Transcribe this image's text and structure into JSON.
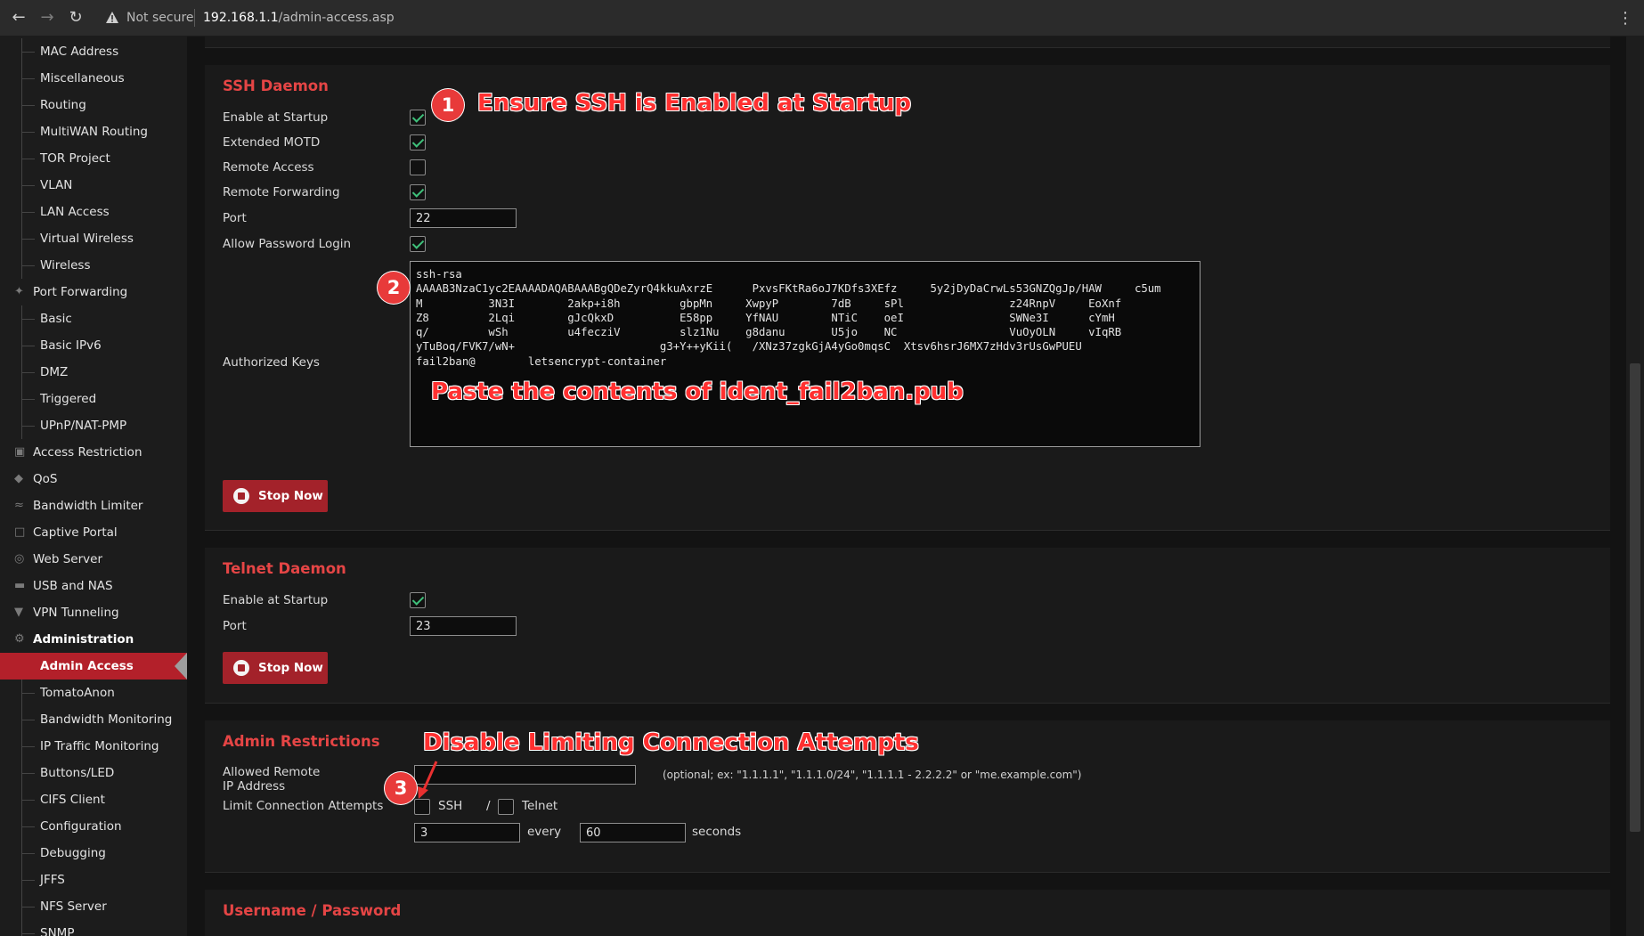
{
  "browser": {
    "security_label": "Not secure",
    "url_host": "192.168.1.1",
    "url_path": "/admin-access.asp"
  },
  "sidebar": {
    "items": [
      {
        "label": "MAC Address",
        "kind": "child"
      },
      {
        "label": "Miscellaneous",
        "kind": "child"
      },
      {
        "label": "Routing",
        "kind": "child"
      },
      {
        "label": "MultiWAN Routing",
        "kind": "child"
      },
      {
        "label": "TOR Project",
        "kind": "child"
      },
      {
        "label": "VLAN",
        "kind": "child"
      },
      {
        "label": "LAN Access",
        "kind": "child"
      },
      {
        "label": "Virtual Wireless",
        "kind": "child"
      },
      {
        "label": "Wireless",
        "kind": "child"
      },
      {
        "label": "Port Forwarding",
        "kind": "parent",
        "icon": "port-forwarding-icon"
      },
      {
        "label": "Basic",
        "kind": "child"
      },
      {
        "label": "Basic IPv6",
        "kind": "child"
      },
      {
        "label": "DMZ",
        "kind": "child"
      },
      {
        "label": "Triggered",
        "kind": "child"
      },
      {
        "label": "UPnP/NAT-PMP",
        "kind": "child"
      },
      {
        "label": "Access Restriction",
        "kind": "parent",
        "icon": "lock-icon"
      },
      {
        "label": "QoS",
        "kind": "parent",
        "icon": "tag-icon"
      },
      {
        "label": "Bandwidth Limiter",
        "kind": "parent",
        "icon": "bandwidth-icon"
      },
      {
        "label": "Captive Portal",
        "kind": "parent",
        "icon": "cast-icon"
      },
      {
        "label": "Web Server",
        "kind": "parent",
        "icon": "globe-icon"
      },
      {
        "label": "USB and NAS",
        "kind": "parent",
        "icon": "folder-icon"
      },
      {
        "label": "VPN Tunneling",
        "kind": "parent",
        "icon": "shield-icon"
      },
      {
        "label": "Administration",
        "kind": "parent-bold",
        "icon": "gear-icon"
      },
      {
        "label": "Admin Access",
        "kind": "active"
      },
      {
        "label": "TomatoAnon",
        "kind": "child"
      },
      {
        "label": "Bandwidth Monitoring",
        "kind": "child"
      },
      {
        "label": "IP Traffic Monitoring",
        "kind": "child"
      },
      {
        "label": "Buttons/LED",
        "kind": "child"
      },
      {
        "label": "CIFS Client",
        "kind": "child"
      },
      {
        "label": "Configuration",
        "kind": "child"
      },
      {
        "label": "Debugging",
        "kind": "child"
      },
      {
        "label": "JFFS",
        "kind": "child"
      },
      {
        "label": "NFS Server",
        "kind": "child"
      },
      {
        "label": "SNMP",
        "kind": "child"
      }
    ]
  },
  "ssh": {
    "title": "SSH Daemon",
    "enable_startup_label": "Enable at Startup",
    "enable_startup_checked": true,
    "extended_motd_label": "Extended MOTD",
    "extended_motd_checked": true,
    "remote_access_label": "Remote Access",
    "remote_access_checked": false,
    "remote_forwarding_label": "Remote Forwarding",
    "remote_forwarding_checked": true,
    "port_label": "Port",
    "port_value": "22",
    "allow_password_label": "Allow Password Login",
    "allow_password_checked": true,
    "authorized_keys_label": "Authorized Keys",
    "authorized_keys_lines": [
      "ssh-rsa",
      "AAAAB3NzaC1yc2EAAAADAQABAAABgQDeZyrQ4kkuAxrzE      PxvsFKtRa6oJ7KDfs3XEfz     5y2jDyDaCrwLs53GNZQgJp/HAW     c5um",
      "M          3N3I        2akp+i8h         gbpMn     XwpyP        7dB     sPl                z24RnpV     EoXnf",
      "Z8         2Lqi        gJcQkxD          E58pp     YfNAU        NTiC    oeI                SWNe3I      cYmH",
      "q/         wSh         u4fecziV         slz1Nu    g8danu       U5jo    NC                 VuOyOLN     vIqRB",
      "yTuBoq/FVK7/wN+                      g3+Y++yKii(   /XNz37zgkGjA4yGo0mqsC  Xtsv6hsrJ6MX7zHdv3rUsGwPUEU",
      "fail2ban@        letsencrypt-container"
    ],
    "stop_label": "Stop Now"
  },
  "telnet": {
    "title": "Telnet Daemon",
    "enable_startup_label": "Enable at Startup",
    "enable_startup_checked": true,
    "port_label": "Port",
    "port_value": "23",
    "stop_label": "Stop Now"
  },
  "restrictions": {
    "title": "Admin Restrictions",
    "allowed_remote_label_1": "Allowed Remote",
    "allowed_remote_label_2": "IP Address",
    "allowed_remote_value": "",
    "allowed_remote_hint": "(optional; ex: \"1.1.1.1\", \"1.1.1.0/24\", \"1.1.1.1 - 2.2.2.2\" or \"me.example.com\")",
    "limit_label": "Limit Connection Attempts",
    "limit_ssh_label": "SSH",
    "limit_ssh_checked": false,
    "slash": "/",
    "limit_telnet_label": "Telnet",
    "limit_telnet_checked": false,
    "attempts_value": "3",
    "every_label": "every",
    "seconds_value": "60",
    "seconds_label": "seconds"
  },
  "userpass": {
    "title": "Username / Password"
  },
  "annotations": {
    "step1_number": "1",
    "step1_text": "Ensure SSH is Enabled at Startup",
    "step2_number": "2",
    "step2_text": "Paste the contents of ident_fail2ban.pub",
    "step3_number": "3",
    "step3_text": "Disable Limiting Connection Attempts",
    "color": "#ff3030"
  }
}
